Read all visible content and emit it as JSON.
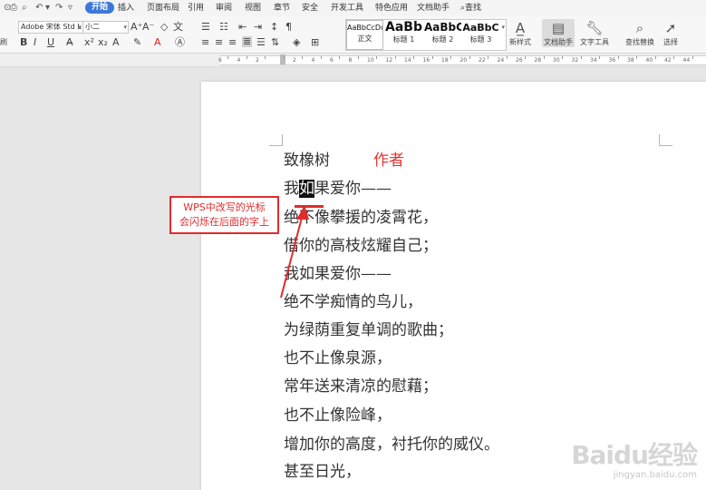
{
  "menubar": {
    "tabs": [
      {
        "label": "开始",
        "active": true
      },
      {
        "label": "插入"
      },
      {
        "label": "页面布局"
      },
      {
        "label": "引用"
      },
      {
        "label": "审阅"
      },
      {
        "label": "视图"
      },
      {
        "label": "章节"
      },
      {
        "label": "安全"
      },
      {
        "label": "开发工具"
      },
      {
        "label": "特色应用"
      },
      {
        "label": "文档助手"
      }
    ],
    "search_label": "查找"
  },
  "ribbon": {
    "left_clip_label": "刷",
    "font_name": "Adobe 宋体 Std L",
    "font_size": "小二",
    "styles": [
      {
        "preview": "AaBbCcDd",
        "name": "正文"
      },
      {
        "preview": "AaBb",
        "name": "标题 1"
      },
      {
        "preview": "AaBbC",
        "name": "标题 2"
      },
      {
        "preview": "AaBbC",
        "name": "标题 3"
      }
    ],
    "new_style_label": "新样式",
    "doc_assistant_label": "文档助手",
    "text_tools_label": "文字工具",
    "find_replace_label": "查找替换",
    "select_label": "选择"
  },
  "ruler": {
    "numbers": [
      "6",
      "4",
      "2",
      "",
      "2",
      "4",
      "6",
      "8",
      "10",
      "12",
      "14",
      "16",
      "18",
      "20",
      "22",
      "24",
      "26",
      "28",
      "30",
      "32",
      "34",
      "36",
      "38",
      "40",
      "42",
      "44"
    ]
  },
  "document": {
    "title_left": "致橡树",
    "author": "作者",
    "line1_pre": "我",
    "line1_cursor": "如",
    "line1_post": "果爱你——",
    "lines": [
      "绝不像攀援的凌霄花，",
      "借你的高枝炫耀自己；",
      "我如果爱你——",
      "绝不学痴情的鸟儿，",
      "为绿荫重复单调的歌曲；",
      "也不止像泉源，",
      "常年送来清凉的慰藉；",
      "也不止像险峰，",
      "增加你的高度，衬托你的威仪。",
      "甚至日光，"
    ]
  },
  "annotation": {
    "line1": "WPS中改写的光标",
    "line2": "会闪烁在后面的字上"
  },
  "watermark": {
    "logo": "Baidu经验",
    "url": "jingyan.baidu.com"
  }
}
